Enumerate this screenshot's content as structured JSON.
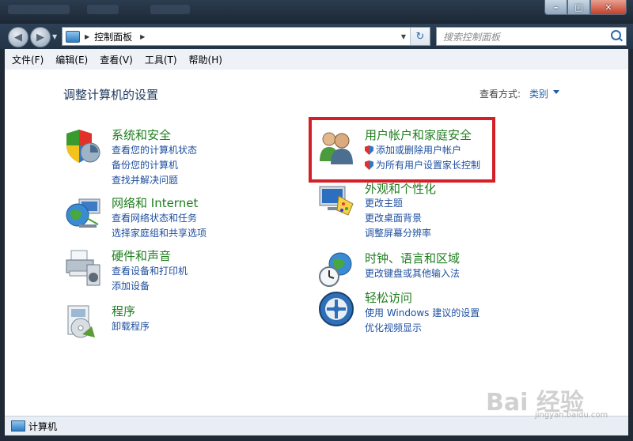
{
  "window": {
    "caption_buttons": {
      "minimize": "–",
      "maximize": "□",
      "close": "✕"
    }
  },
  "nav": {
    "back_icon": "back-arrow-icon",
    "forward_icon": "forward-arrow-icon",
    "address_path": "控制面板",
    "search_placeholder": "搜索控制面板"
  },
  "menu": [
    "文件(F)",
    "编辑(E)",
    "查看(V)",
    "工具(T)",
    "帮助(H)"
  ],
  "main": {
    "title": "调整计算机的设置",
    "view_by_label": "查看方式:",
    "view_by_value": "类别"
  },
  "categories_left": [
    {
      "title": "系统和安全",
      "links": [
        "查看您的计算机状态",
        "备份您的计算机",
        "查找并解决问题"
      ],
      "icon": "shield-icon"
    },
    {
      "title": "网络和 Internet",
      "links": [
        "查看网络状态和任务",
        "选择家庭组和共享选项"
      ],
      "icon": "network-globe-icon"
    },
    {
      "title": "硬件和声音",
      "links": [
        "查看设备和打印机",
        "添加设备"
      ],
      "icon": "printer-icon"
    },
    {
      "title": "程序",
      "links": [
        "卸载程序"
      ],
      "icon": "programs-icon"
    }
  ],
  "categories_right": [
    {
      "title": "用户帐户和家庭安全",
      "links": [
        "添加或删除用户帐户",
        "为所有用户设置家长控制"
      ],
      "icon": "users-icon"
    },
    {
      "title": "外观和个性化",
      "links": [
        "更改主题",
        "更改桌面背景",
        "调整屏幕分辨率"
      ],
      "icon": "monitor-palette-icon"
    },
    {
      "title": "时钟、语言和区域",
      "links": [
        "更改键盘或其他输入法"
      ],
      "icon": "globe-clock-icon"
    },
    {
      "title": "轻松访问",
      "links": [
        "使用 Windows 建议的设置",
        "优化视频显示"
      ],
      "icon": "ease-of-access-icon"
    }
  ],
  "status": {
    "text": "计算机"
  },
  "watermark": {
    "brand": "Bai 经验",
    "url": "jingyan.baidu.com"
  },
  "colors": {
    "highlight": "#d51f28",
    "category_title": "#1e7d1e",
    "link": "#1e4fa0"
  }
}
